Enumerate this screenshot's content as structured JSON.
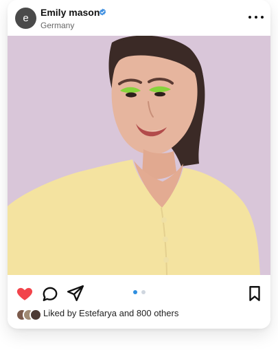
{
  "post": {
    "avatar_letter": "e",
    "username": "Emily mason",
    "location": "Germany",
    "photo": {
      "subject": "portrait-woman-yellow-cardigan",
      "colors": {
        "background": "#d9c6d9",
        "cardigan": "#f4e3a0",
        "skin": "#e6b59e",
        "hair": "#3b2a26",
        "eyeshadow": "#86d43b"
      }
    },
    "carousel": {
      "count": 2,
      "active_index": 0
    },
    "likes": {
      "liked_by_prefix": "Liked by",
      "liked_by_user": "Estefarya",
      "and_others": "and 800 others"
    }
  },
  "colors": {
    "verified": "#3f8fe0",
    "heart": "#f2444b",
    "active_dot": "#2f8fe0",
    "inactive_dot": "#cfd6df",
    "icon": "#111111"
  },
  "icons": {
    "verified": "verified-badge-icon",
    "more": "more-options-icon",
    "like": "heart-filled-icon",
    "comment": "comment-icon",
    "share": "send-icon",
    "save": "bookmark-icon"
  }
}
